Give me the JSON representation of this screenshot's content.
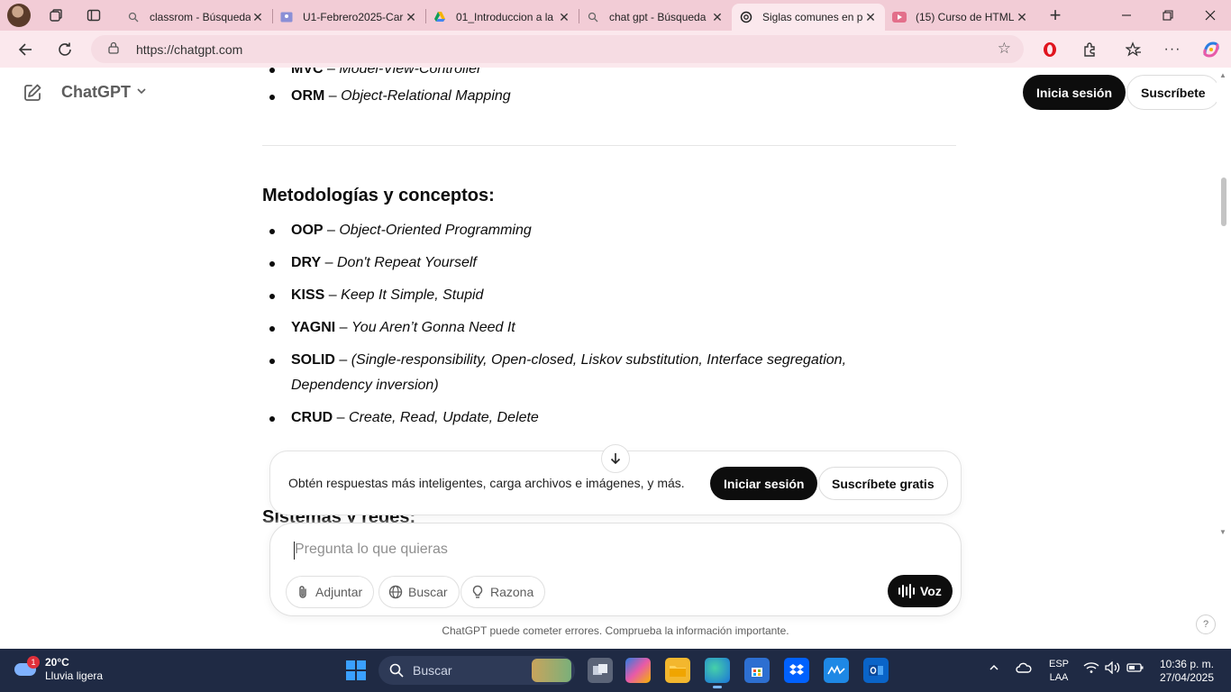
{
  "browser": {
    "tabs": [
      {
        "title": "classrom - Búsqueda",
        "icon": "search-icon"
      },
      {
        "title": "U1-Febrero2025-Car",
        "icon": "classroom-icon"
      },
      {
        "title": "01_Introduccion a la",
        "icon": "drive-icon"
      },
      {
        "title": "chat gpt - Búsqueda",
        "icon": "search-icon"
      },
      {
        "title": "Siglas comunes en p",
        "icon": "chatgpt-icon"
      },
      {
        "title": "(15) Curso de HTML",
        "icon": "youtube-icon"
      }
    ],
    "url": "https://chatgpt.com"
  },
  "header": {
    "brand": "ChatGPT",
    "login_label": "Inicia sesión",
    "subscribe_label": "Suscríbete"
  },
  "content": {
    "top_items": [
      {
        "abbr": "MVC",
        "sep": " – ",
        "desc": "Model-View-Controller"
      },
      {
        "abbr": "ORM",
        "sep": " – ",
        "desc": "Object-Relational Mapping"
      }
    ],
    "section_title": "Metodologías y conceptos:",
    "items": [
      {
        "abbr": "OOP",
        "sep": " – ",
        "desc": "Object-Oriented Programming"
      },
      {
        "abbr": "DRY",
        "sep": " – ",
        "desc": "Don't Repeat Yourself"
      },
      {
        "abbr": "KISS",
        "sep": " – ",
        "desc": "Keep It Simple, Stupid"
      },
      {
        "abbr": "YAGNI",
        "sep": " – ",
        "desc": "You Aren’t Gonna Need It"
      },
      {
        "abbr": "SOLID",
        "sep": " – ",
        "desc": "(Single-responsibility, Open-closed, Liskov substitution, Interface segregation, Dependency inversion)"
      },
      {
        "abbr": "CRUD",
        "sep": " – ",
        "desc": "Create, Read, Update, Delete"
      }
    ],
    "next_section_title": "Sistemas y redes:"
  },
  "promo": {
    "text": "Obtén respuestas más inteligentes, carga archivos e imágenes, y más.",
    "login_label": "Iniciar sesión",
    "subscribe_label": "Suscríbete gratis"
  },
  "composer": {
    "placeholder": "Pregunta lo que quieras",
    "attach_label": "Adjuntar",
    "search_label": "Buscar",
    "reason_label": "Razona",
    "voice_label": "Voz"
  },
  "disclaimer": "ChatGPT puede cometer errores. Comprueba la información importante.",
  "help_label": "?",
  "taskbar": {
    "weather_temp": "20°C",
    "weather_desc": "Lluvia ligera",
    "weather_badge": "1",
    "search_label": "Buscar",
    "lang_top": "ESP",
    "lang_bottom": "LAA",
    "time": "10:36 p. m.",
    "date": "27/04/2025"
  }
}
